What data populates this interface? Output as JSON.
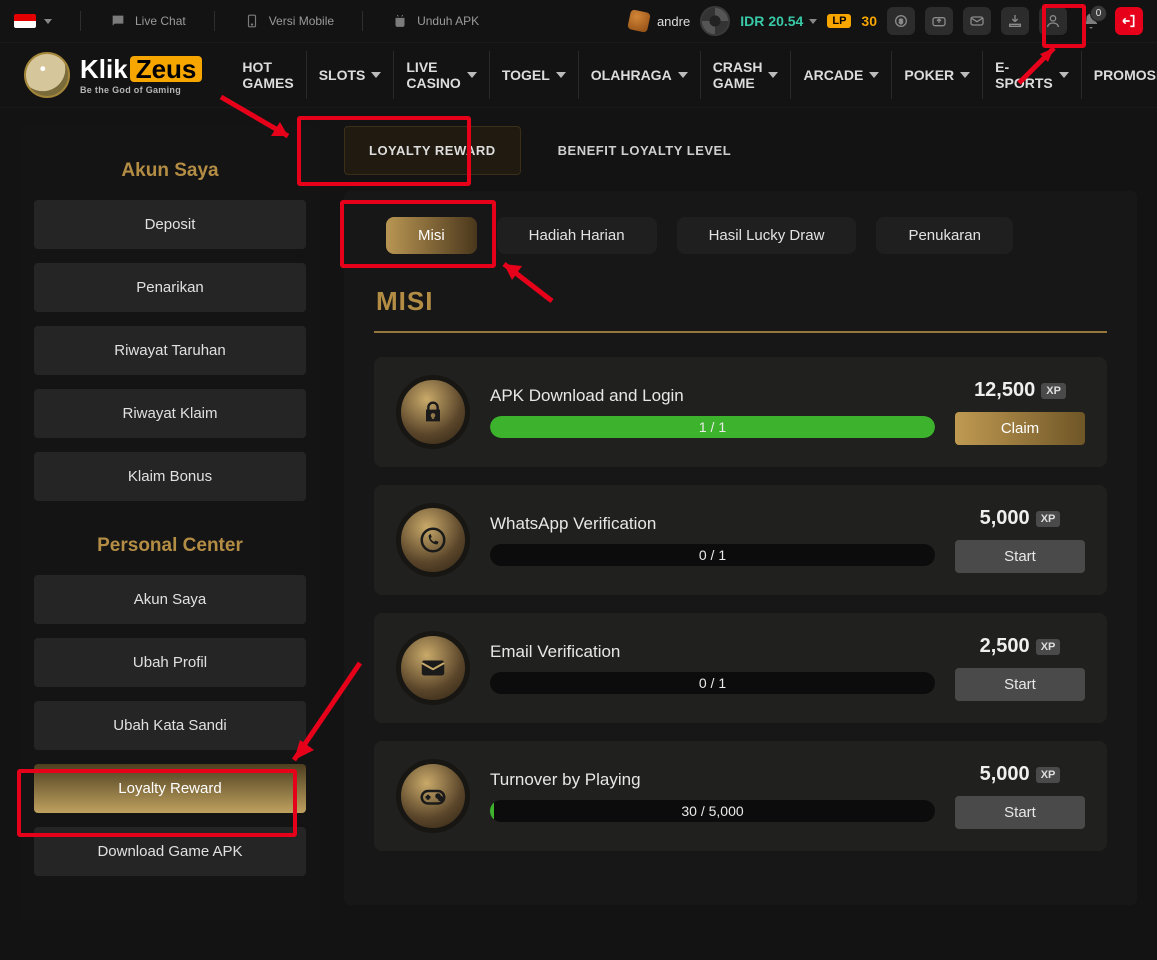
{
  "topbar": {
    "live_chat": "Live Chat",
    "mobile_version": "Versi Mobile",
    "download_apk": "Unduh APK",
    "username": "andre",
    "currency": "IDR",
    "balance": "20.54",
    "lp_label": "LP",
    "lp_amount": "30",
    "notif_count": "0"
  },
  "brand": {
    "part1": "Klik",
    "part2": "Zeus",
    "tagline": "Be the God of Gaming"
  },
  "nav": [
    {
      "label": "HOT GAMES",
      "caret": false
    },
    {
      "label": "SLOTS",
      "caret": true
    },
    {
      "label": "LIVE CASINO",
      "caret": true
    },
    {
      "label": "TOGEL",
      "caret": true
    },
    {
      "label": "OLAHRAGA",
      "caret": true
    },
    {
      "label": "CRASH GAME",
      "caret": true
    },
    {
      "label": "ARCADE",
      "caret": true
    },
    {
      "label": "POKER",
      "caret": true
    },
    {
      "label": "E-SPORTS",
      "caret": true
    },
    {
      "label": "PROMOSI",
      "caret": false
    }
  ],
  "sidebar": {
    "section1_title": "Akun Saya",
    "section1": [
      "Deposit",
      "Penarikan",
      "Riwayat Taruhan",
      "Riwayat Klaim",
      "Klaim Bonus"
    ],
    "section2_title": "Personal Center",
    "section2": [
      "Akun Saya",
      "Ubah Profil",
      "Ubah Kata Sandi",
      "Loyalty Reward",
      "Download Game APK"
    ],
    "active": "Loyalty Reward"
  },
  "topTabs": [
    {
      "label": "LOYALTY REWARD",
      "active": true
    },
    {
      "label": "BENEFIT LOYALTY LEVEL",
      "active": false
    }
  ],
  "pills": [
    {
      "label": "Misi",
      "active": true
    },
    {
      "label": "Hadiah Harian",
      "active": false
    },
    {
      "label": "Hasil Lucky Draw",
      "active": false
    },
    {
      "label": "Penukaran",
      "active": false
    }
  ],
  "sectionTitle": "MISI",
  "xpBadge": "XP",
  "missions": [
    {
      "icon": "lock",
      "title": "APK Download and Login",
      "progress_text": "1 / 1",
      "progress_pct": 100,
      "xp": "12,500",
      "action": "Claim",
      "action_type": "claim"
    },
    {
      "icon": "whatsapp",
      "title": "WhatsApp Verification",
      "progress_text": "0 / 1",
      "progress_pct": 0,
      "xp": "5,000",
      "action": "Start",
      "action_type": "start"
    },
    {
      "icon": "mail",
      "title": "Email Verification",
      "progress_text": "0 / 1",
      "progress_pct": 0,
      "xp": "2,500",
      "action": "Start",
      "action_type": "start"
    },
    {
      "icon": "gamepad",
      "title": "Turnover by Playing",
      "progress_text": "30 / 5,000",
      "progress_pct": 1,
      "xp": "5,000",
      "action": "Start",
      "action_type": "start"
    }
  ]
}
